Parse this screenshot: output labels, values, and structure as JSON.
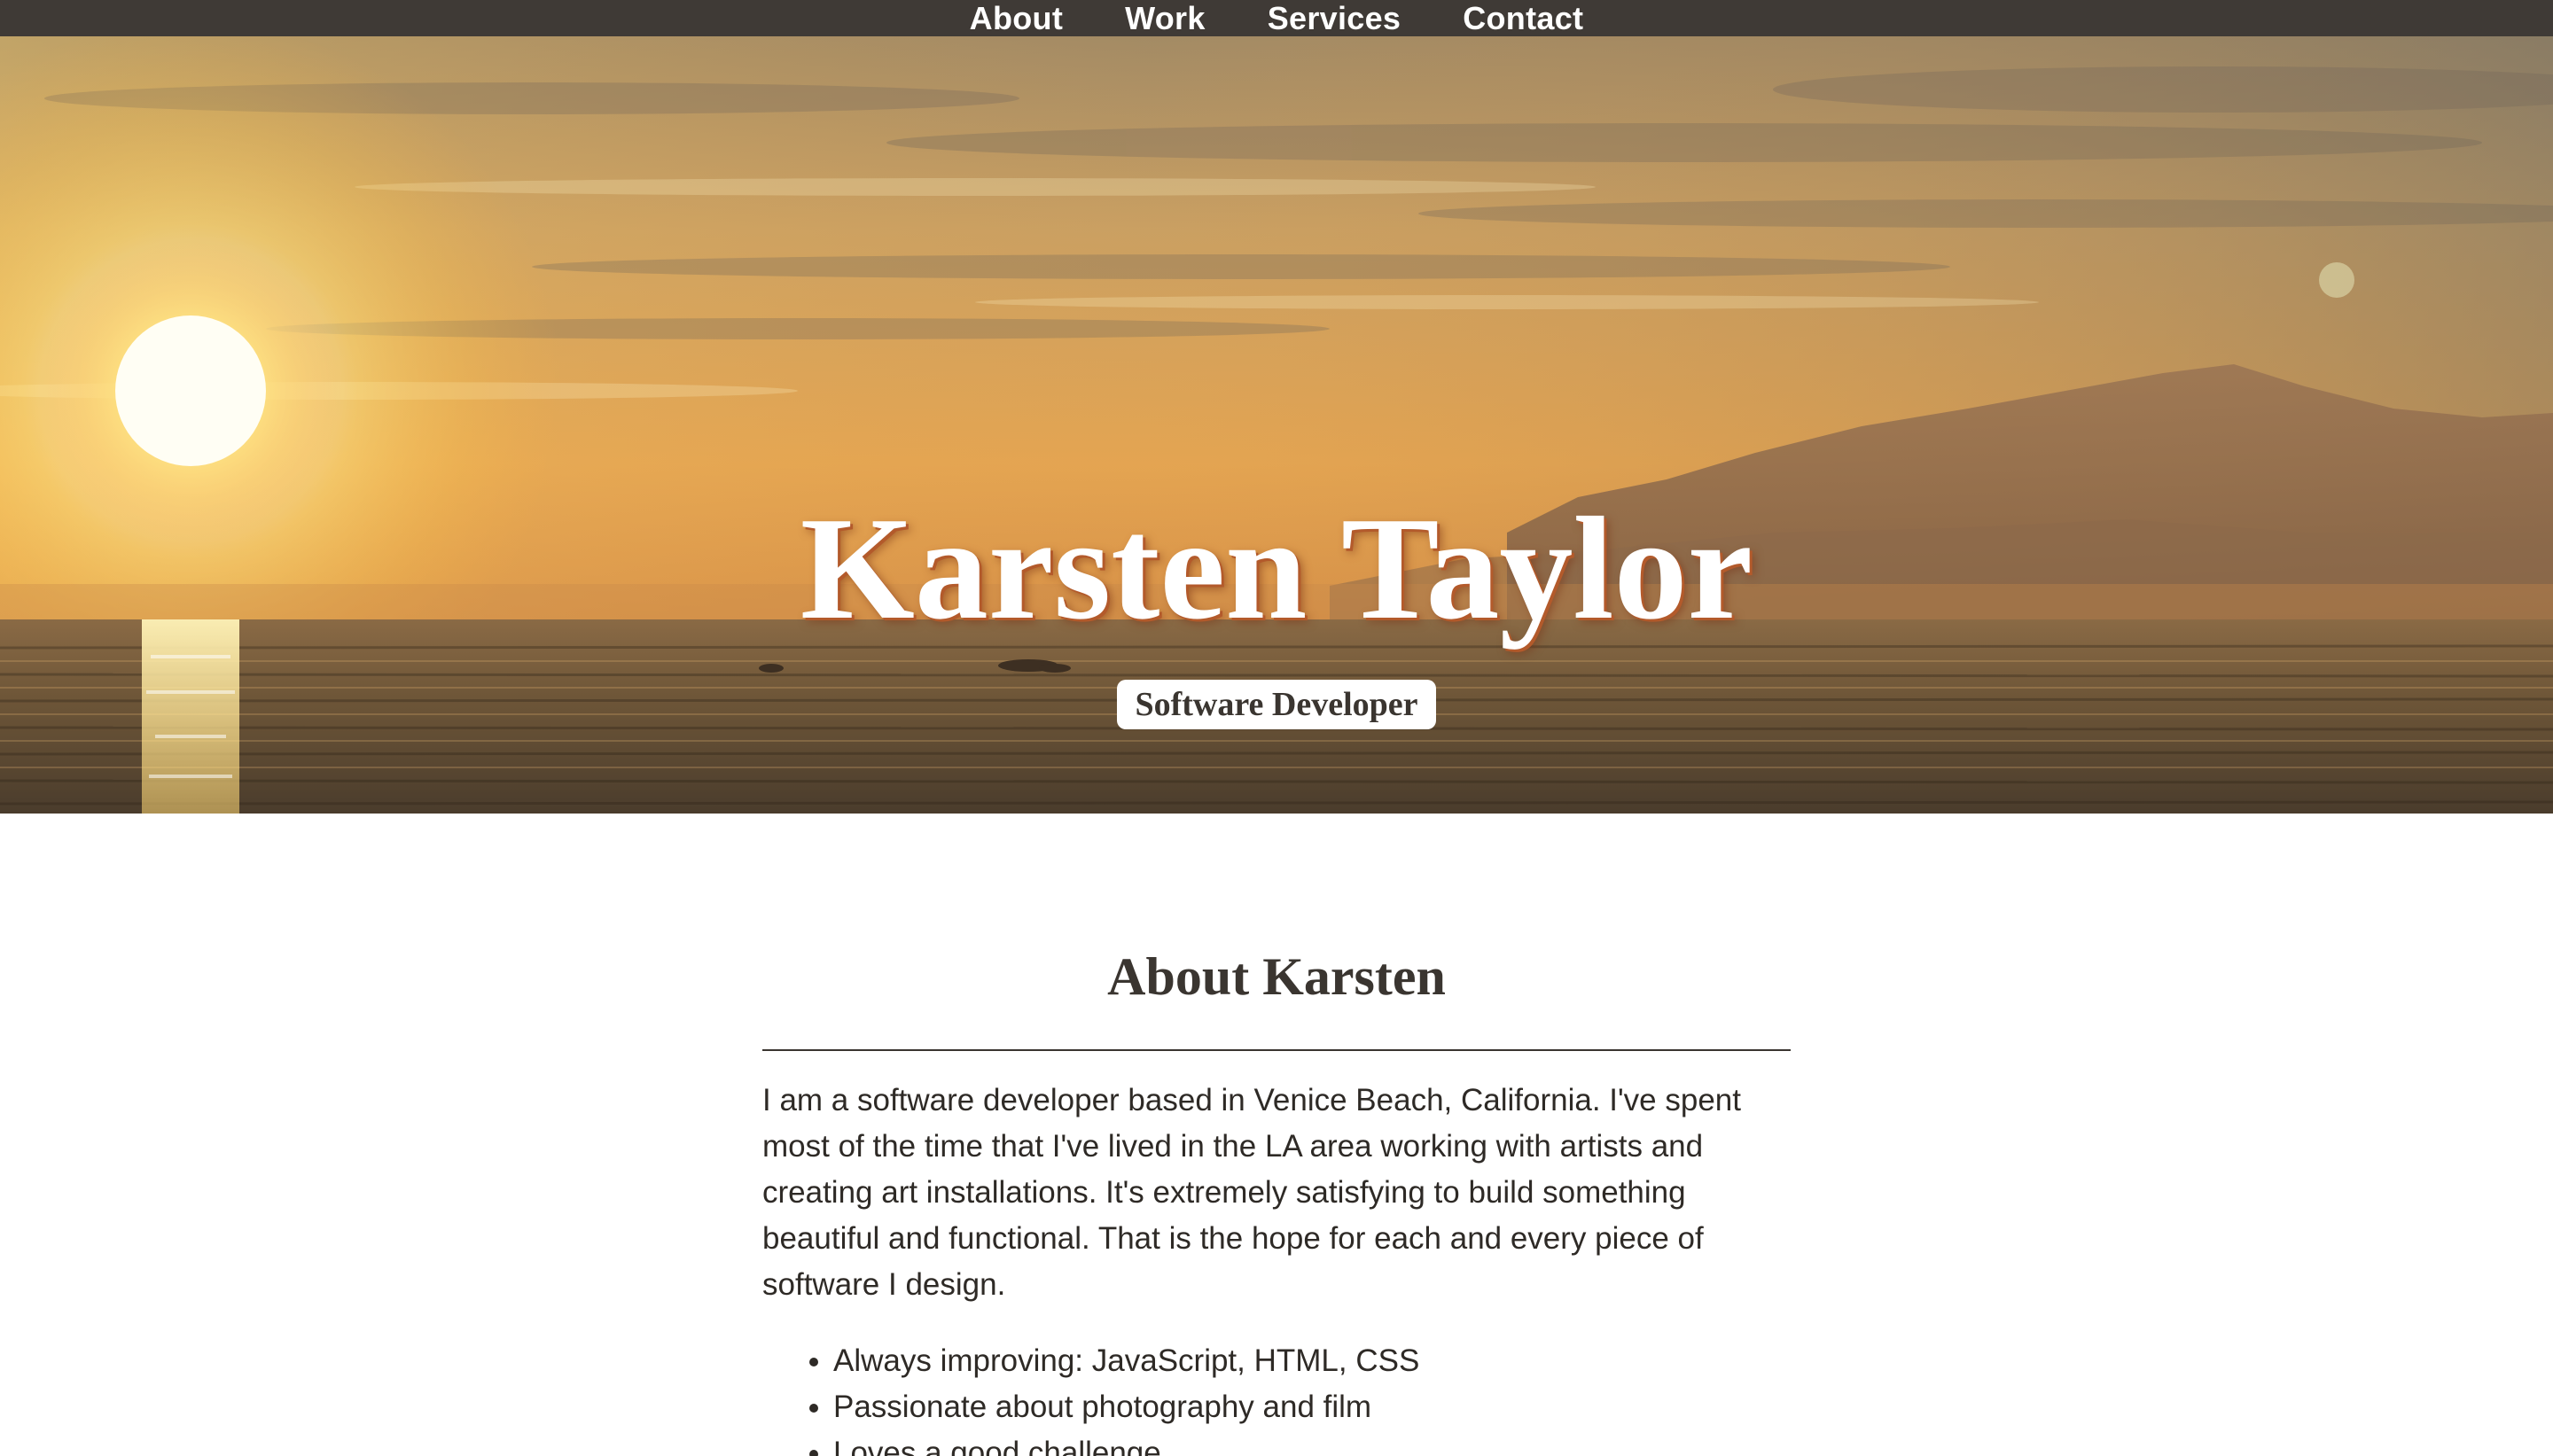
{
  "nav": {
    "items": [
      {
        "label": "About"
      },
      {
        "label": "Work"
      },
      {
        "label": "Services"
      },
      {
        "label": "Contact"
      }
    ]
  },
  "hero": {
    "name": "Karsten Taylor",
    "role": "Software Developer"
  },
  "about": {
    "heading": "About Karsten",
    "paragraph": "I am a software developer based in Venice Beach, California. I've spent most of the time that I've lived in the LA area working with artists and creating art installations. It's extremely satisfying to build something beautiful and functional. That is the hope for each and every piece of software I design.",
    "bullets": [
      "Always improving: JavaScript, HTML, CSS",
      "Passionate about photography and film",
      "Loves a good challenge"
    ]
  },
  "colors": {
    "nav_bg": "#3f3a36",
    "text": "#3a3530",
    "title_shadow": "#b35a2b"
  }
}
